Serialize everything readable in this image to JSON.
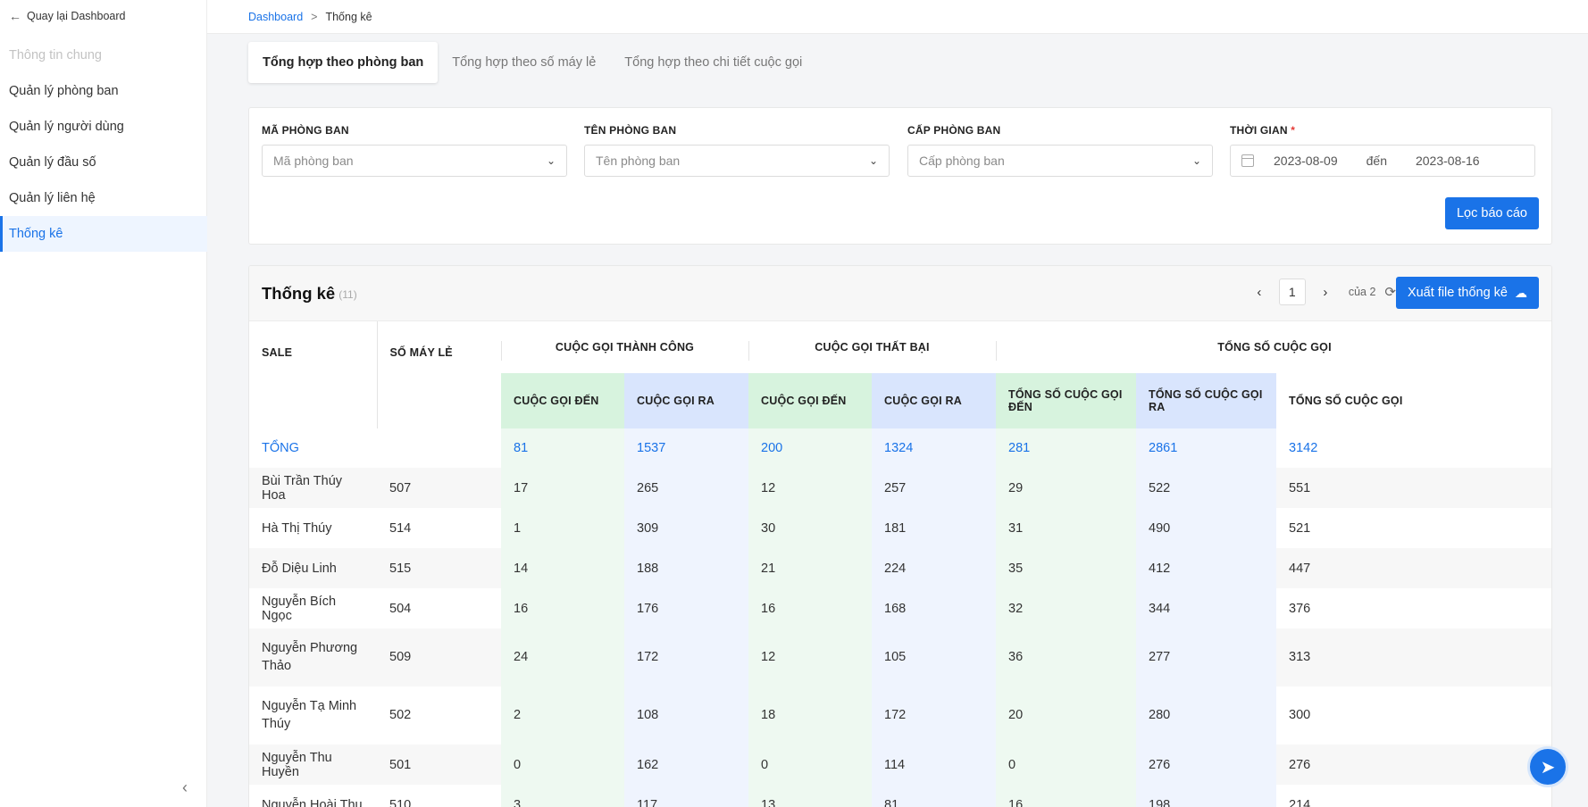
{
  "sidebar": {
    "back_label": "Quay lại Dashboard",
    "items": [
      {
        "label": "Thông tin chung"
      },
      {
        "label": "Quản lý phòng ban"
      },
      {
        "label": "Quản lý người dùng"
      },
      {
        "label": "Quản lý đầu số"
      },
      {
        "label": "Quản lý liên hệ"
      },
      {
        "label": "Thống kê"
      }
    ]
  },
  "breadcrumb": {
    "home": "Dashboard",
    "separator": ">",
    "current": "Thống kê"
  },
  "tabs": [
    {
      "label": "Tổng hợp theo phòng ban"
    },
    {
      "label": "Tổng hợp theo số máy lẻ"
    },
    {
      "label": "Tổng hợp theo chi tiết cuộc gọi"
    }
  ],
  "filters": {
    "department_code": {
      "label": "MÃ PHÒNG BAN",
      "placeholder": "Mã phòng ban"
    },
    "department_name": {
      "label": "TÊN PHÒNG BAN",
      "placeholder": "Tên phòng ban"
    },
    "department_level": {
      "label": "CẤP PHÒNG BAN",
      "placeholder": "Cấp phòng ban"
    },
    "time": {
      "label": "THỜI GIAN",
      "required_mark": "*",
      "from": "2023-08-09",
      "to_label": "đến",
      "to": "2023-08-16"
    },
    "filter_button": "Lọc báo cáo"
  },
  "stats": {
    "title": "Thống kê",
    "count": "(11)",
    "page": "1",
    "of_label": "của 2",
    "export_button": "Xuất file thống kê",
    "headers": {
      "sale": "SALE",
      "ext": "SỐ MÁY LẺ",
      "group_success": "CUỘC GỌI THÀNH CÔNG",
      "group_failed": "CUỘC GỌI THẤT BẠI",
      "group_total": "TỔNG SỐ CUỘC GỌI",
      "incoming": "CUỘC GỌI ĐẾN",
      "outgoing": "CUỘC GỌI RA",
      "total_incoming": "TỔNG SỐ CUỘC GỌI ĐẾN",
      "total_outgoing": "TỔNG SỐ CUỘC GỌI RA",
      "total_calls": "TỔNG SỐ CUỘC GỌI"
    },
    "total_row": {
      "label": "TỔNG",
      "values": [
        "81",
        "1537",
        "200",
        "1324",
        "281",
        "2861",
        "3142"
      ]
    },
    "rows": [
      {
        "name": "Bùi Trần Thúy Hoa",
        "ext": "507",
        "values": [
          "17",
          "265",
          "12",
          "257",
          "29",
          "522",
          "551"
        ]
      },
      {
        "name": "Hà Thị Thúy",
        "ext": "514",
        "values": [
          "1",
          "309",
          "30",
          "181",
          "31",
          "490",
          "521"
        ]
      },
      {
        "name": "Đỗ Diệu Linh",
        "ext": "515",
        "values": [
          "14",
          "188",
          "21",
          "224",
          "35",
          "412",
          "447"
        ]
      },
      {
        "name": "Nguyễn Bích Ngọc",
        "ext": "504",
        "values": [
          "16",
          "176",
          "16",
          "168",
          "32",
          "344",
          "376"
        ]
      },
      {
        "name": "Nguyễn Phương Thảo",
        "ext": "509",
        "values": [
          "24",
          "172",
          "12",
          "105",
          "36",
          "277",
          "313"
        ]
      },
      {
        "name": "Nguyễn Tạ Minh Thúy",
        "ext": "502",
        "values": [
          "2",
          "108",
          "18",
          "172",
          "20",
          "280",
          "300"
        ]
      },
      {
        "name": "Nguyễn Thu Huyền",
        "ext": "501",
        "values": [
          "0",
          "162",
          "0",
          "114",
          "0",
          "276",
          "276"
        ]
      },
      {
        "name": "Nguyễn Hoài Thu",
        "ext": "510",
        "values": [
          "3",
          "117",
          "13",
          "81",
          "16",
          "198",
          "214"
        ]
      }
    ]
  },
  "colors": {
    "accent": "#1a73e8",
    "green_header": "#d7f3de",
    "blue_header": "#d9e5fd"
  },
  "icons": [
    "arrow-left-icon",
    "chevron-down-icon",
    "calendar-icon",
    "chevron-left-icon",
    "chevron-right-icon",
    "refresh-icon",
    "cloud-upload-icon",
    "send-icon",
    "collapse-icon"
  ]
}
